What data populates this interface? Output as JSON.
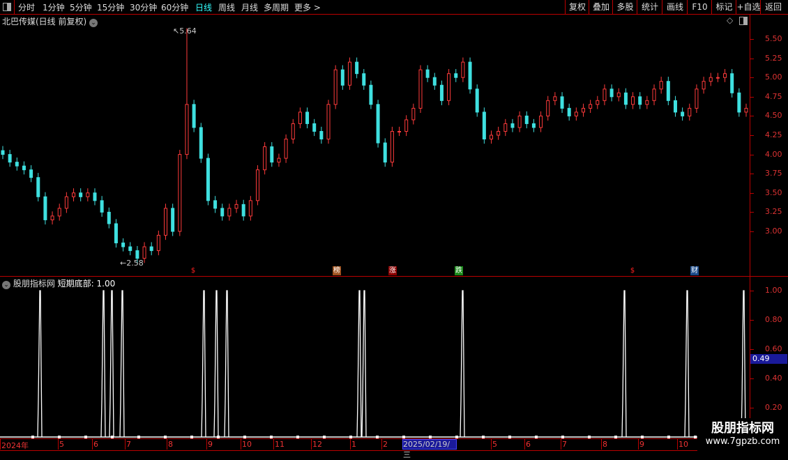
{
  "toolbar": {
    "tabs": [
      "分时",
      "1分钟",
      "5分钟",
      "15分钟",
      "30分钟",
      "60分钟",
      "日线",
      "周线",
      "月线",
      "多周期",
      "更多 >"
    ],
    "active": "日线",
    "right_buttons": [
      "复权",
      "叠加",
      "多股",
      "统计",
      "画线",
      "F10",
      "标记",
      "+自选",
      "返回"
    ]
  },
  "main": {
    "title": "北巴传媒(日线 前复权)",
    "high_label": "5.64",
    "low_label": "2.58",
    "price_ticks": [
      "5.50",
      "5.25",
      "5.00",
      "4.75",
      "4.50",
      "4.25",
      "4.00",
      "3.75",
      "3.50",
      "3.25",
      "3.00"
    ],
    "closes": [
      4.0,
      3.9,
      3.85,
      3.8,
      3.7,
      3.45,
      3.15,
      3.2,
      3.3,
      3.45,
      3.5,
      3.45,
      3.5,
      3.4,
      3.25,
      3.1,
      2.85,
      2.8,
      2.75,
      2.65,
      2.8,
      2.75,
      2.95,
      3.3,
      3.0,
      4.0,
      4.65,
      4.35,
      3.95,
      3.4,
      3.3,
      3.2,
      3.3,
      3.35,
      3.2,
      3.4,
      3.8,
      4.1,
      3.9,
      3.95,
      4.2,
      4.4,
      4.55,
      4.4,
      4.3,
      4.2,
      4.65,
      5.1,
      4.9,
      5.2,
      5.05,
      4.9,
      4.65,
      4.15,
      3.9,
      4.3,
      4.3,
      4.45,
      4.6,
      5.1,
      5.0,
      4.9,
      4.7,
      5.05,
      5.0,
      5.2,
      4.85,
      4.55,
      4.2,
      4.25,
      4.3,
      4.4,
      4.35,
      4.5,
      4.4,
      4.35,
      4.5,
      4.7,
      4.75,
      4.6,
      4.5,
      4.55,
      4.6,
      4.65,
      4.7,
      4.85,
      4.75,
      4.8,
      4.65,
      4.75,
      4.65,
      4.7,
      4.85,
      4.95,
      4.7,
      4.55,
      4.5,
      4.6,
      4.85,
      4.95,
      5.0,
      5.0,
      5.05,
      4.8,
      4.55,
      4.6
    ],
    "markers": [
      {
        "text": "$",
        "color": "#ff2020",
        "bg": "transparent"
      },
      {
        "text": "榜",
        "color": "#fff",
        "bg": "#a0521e"
      },
      {
        "text": "涨",
        "color": "#fff",
        "bg": "#8b0000"
      },
      {
        "text": "跌",
        "color": "#fff",
        "bg": "#1a8a1a"
      },
      {
        "text": "$",
        "color": "#ff2020",
        "bg": "transparent"
      },
      {
        "text": "财",
        "color": "#fff",
        "bg": "#1a4a8a"
      }
    ]
  },
  "indicator": {
    "name": "股朋指标网",
    "label": "短期底部: 1.00",
    "ticks": [
      "1.00",
      "0.80",
      "0.60",
      "0.40",
      "0.20"
    ],
    "current": "0.49",
    "signals": [
      57,
      148,
      160,
      175,
      292,
      310,
      325,
      515,
      522,
      663,
      895,
      985,
      1066
    ]
  },
  "dates": {
    "labels": [
      "2024年",
      "5",
      "6",
      "7",
      "8",
      "9",
      "10",
      "11",
      "12",
      "1",
      "2",
      "5",
      "6",
      "7",
      "8",
      "9",
      "10"
    ],
    "cursor": "2025/02/19/三"
  },
  "watermark": {
    "title": "股朋指标网",
    "url": "www.7gpzb.com"
  },
  "colors": {
    "up": "#ff3b3b",
    "down": "#3fe0e0",
    "axis": "#b00000"
  }
}
